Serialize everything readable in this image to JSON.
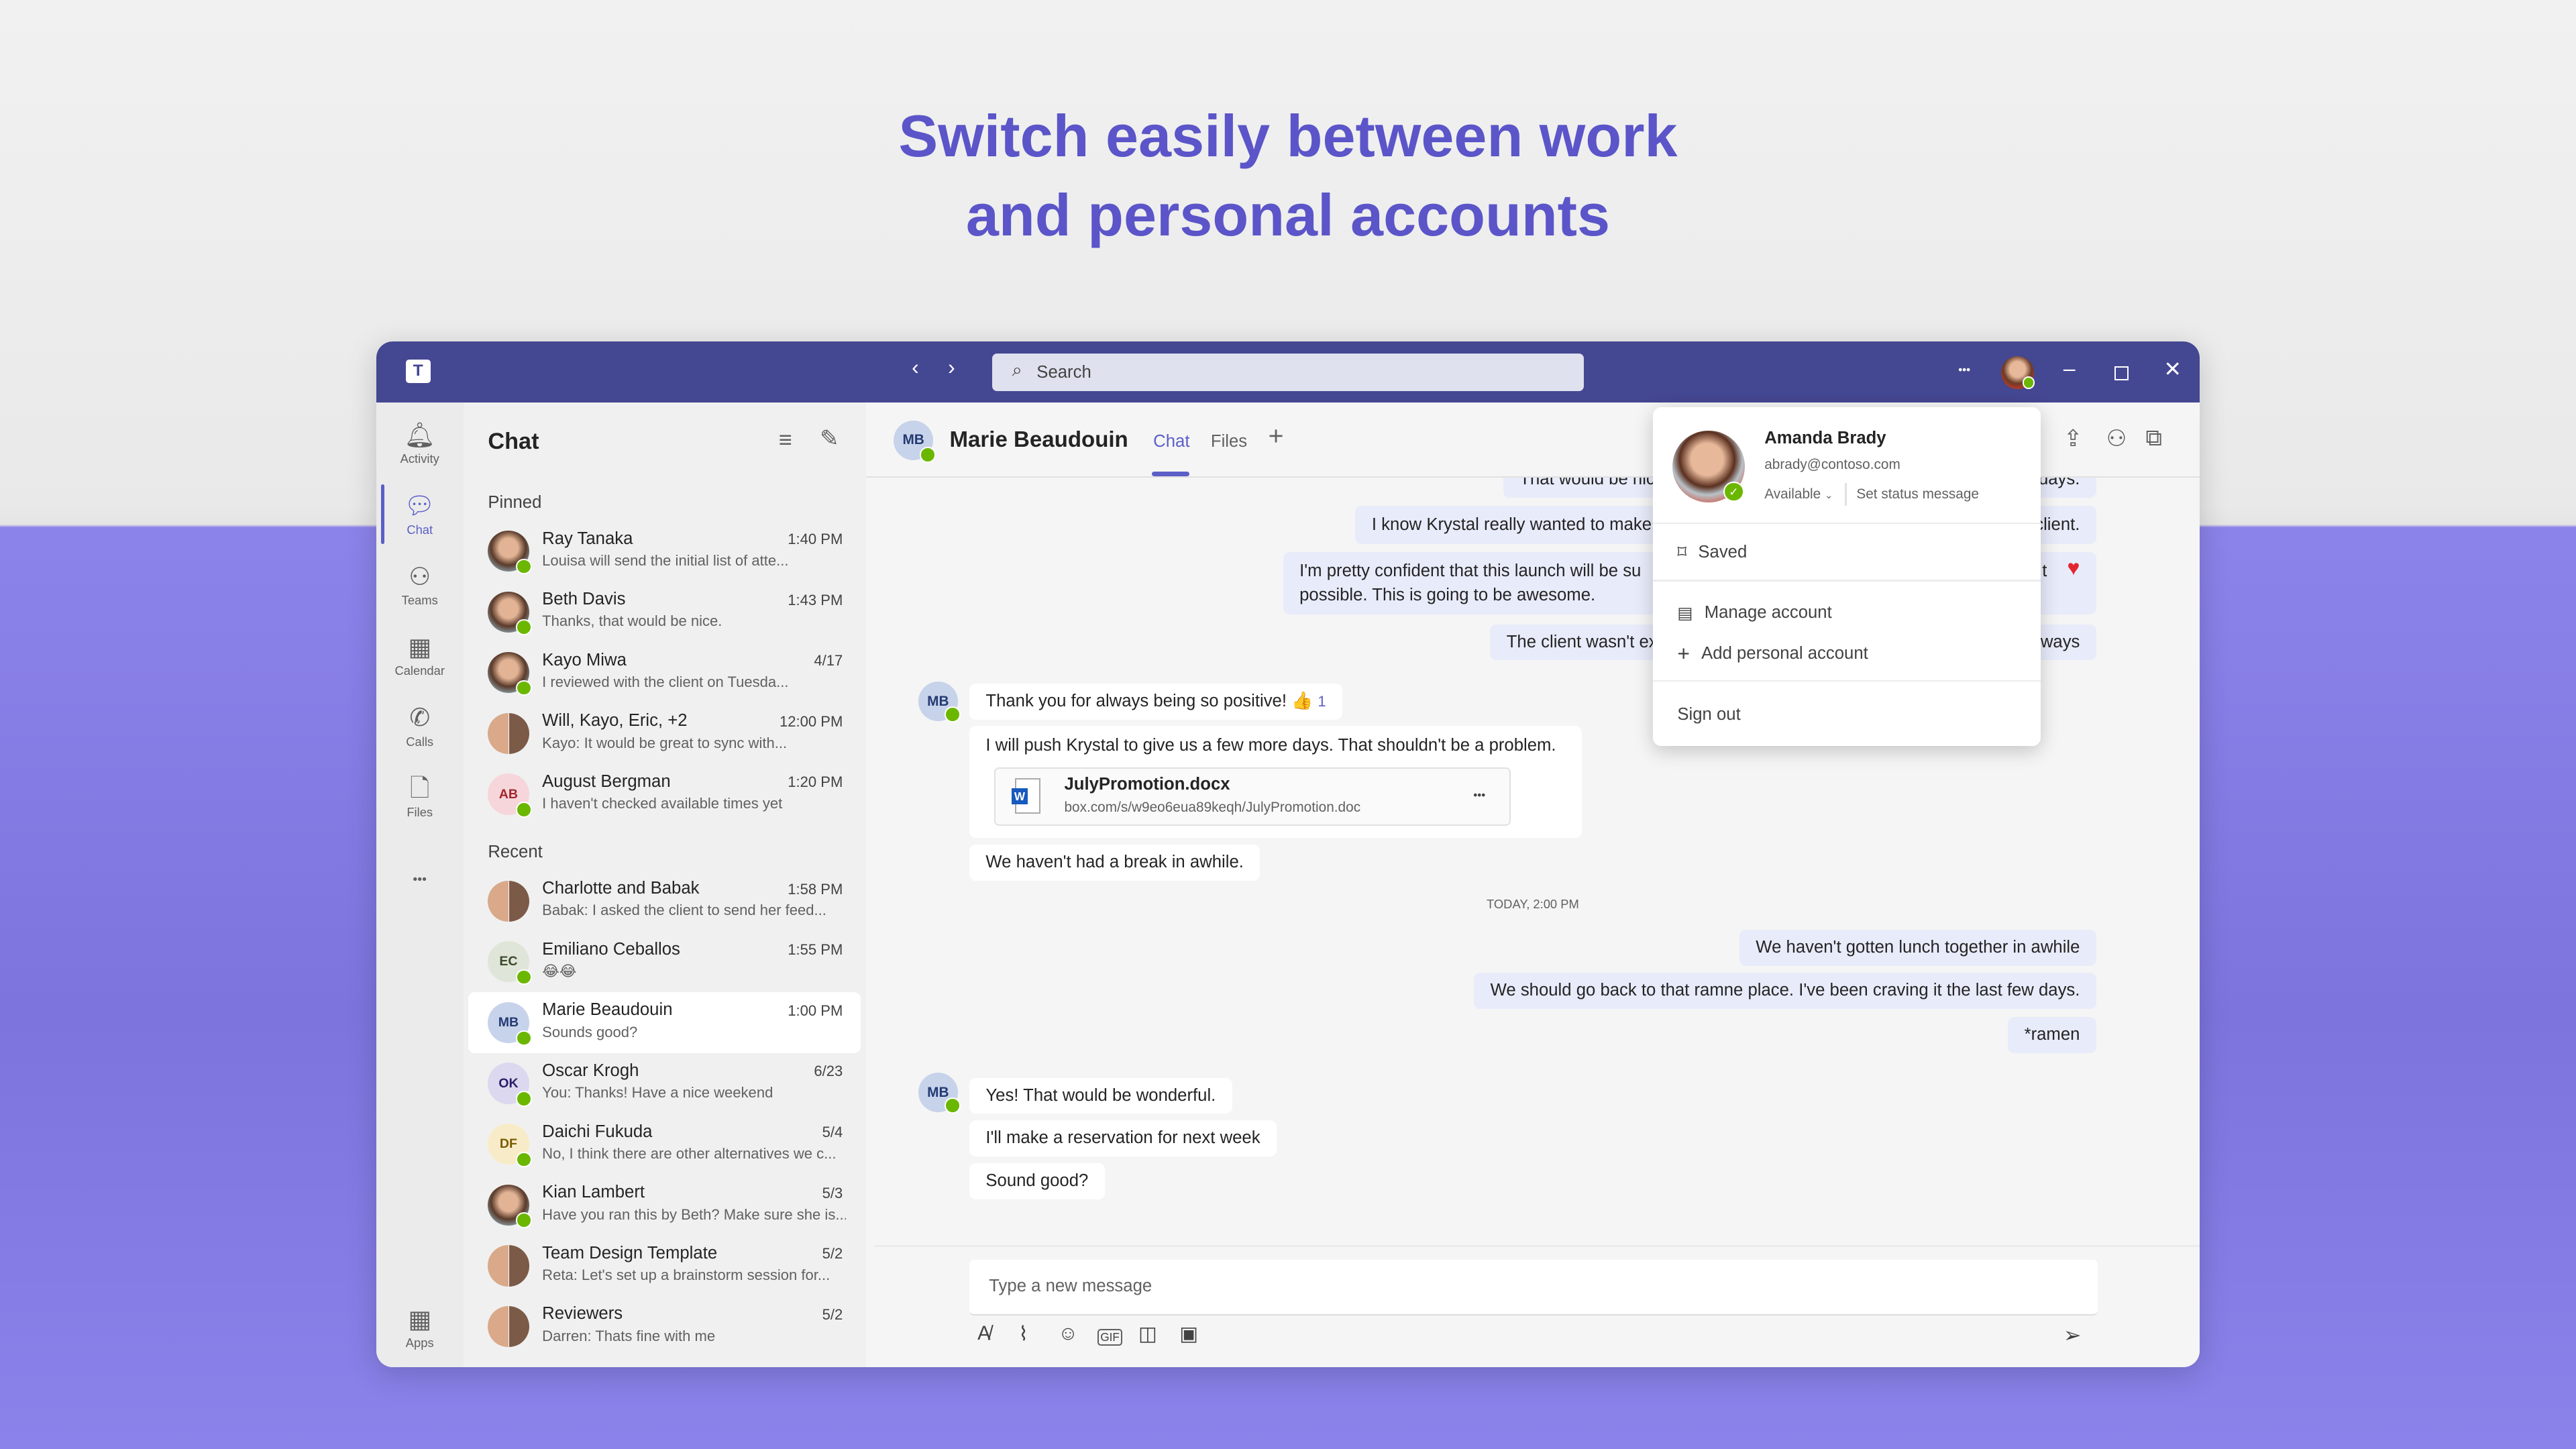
{
  "headline": {
    "line1": "Switch easily between work",
    "line2": "and personal accounts"
  },
  "colors": {
    "brand": "#444791",
    "accent": "#5b5fc7",
    "headline": "#5b55c9",
    "presence": "#6bb700",
    "my_bubble": "#e8ebfa",
    "heart": "#e3262f"
  },
  "titlebar": {
    "search_placeholder": "Search",
    "more": "•••",
    "icons": [
      "teams-logo-icon",
      "back-icon",
      "forward-icon",
      "search-icon",
      "more-icon",
      "minimize-icon",
      "maximize-icon",
      "close-icon"
    ]
  },
  "rail": {
    "items": [
      {
        "label": "Activity",
        "icon": "bell-icon"
      },
      {
        "label": "Chat",
        "icon": "chat-icon",
        "active": true
      },
      {
        "label": "Teams",
        "icon": "teams-icon"
      },
      {
        "label": "Calendar",
        "icon": "calendar-icon"
      },
      {
        "label": "Calls",
        "icon": "phone-icon"
      },
      {
        "label": "Files",
        "icon": "file-icon"
      }
    ],
    "more": "•••",
    "apps": "Apps"
  },
  "chatlist": {
    "title": "Chat",
    "pinned_label": "Pinned",
    "recent_label": "Recent",
    "pinned": [
      {
        "name": "Ray Tanaka",
        "time": "1:40 PM",
        "preview": "Louisa will send the initial list of atte...",
        "avatar": "photo"
      },
      {
        "name": "Beth Davis",
        "time": "1:43 PM",
        "preview": "Thanks, that would be nice.",
        "avatar": "photo"
      },
      {
        "name": "Kayo Miwa",
        "time": "4/17",
        "preview": "I reviewed with the client on Tuesda...",
        "avatar": "photo"
      },
      {
        "name": "Will, Kayo, Eric, +2",
        "time": "12:00 PM",
        "preview": "Kayo: It would be great to sync with...",
        "avatar": "group"
      },
      {
        "name": "August Bergman",
        "time": "1:20 PM",
        "preview": "I haven't checked available times yet",
        "initials": "AB",
        "bg": "#f6d6da",
        "fg": "#a4262c"
      }
    ],
    "recent": [
      {
        "name": "Charlotte and Babak",
        "time": "1:58 PM",
        "preview": "Babak: I asked the client to send her feed...",
        "avatar": "group"
      },
      {
        "name": "Emiliano Ceballos",
        "time": "1:55 PM",
        "preview": "😂😂",
        "initials": "EC",
        "bg": "#dfe5d8",
        "fg": "#3b4a2a"
      },
      {
        "name": "Marie Beaudouin",
        "time": "1:00 PM",
        "preview": "Sounds good?",
        "initials": "MB",
        "bg": "#c7d3ea",
        "fg": "#243a73",
        "selected": true
      },
      {
        "name": "Oscar Krogh",
        "time": "6/23",
        "preview": "You: Thanks! Have a nice weekend",
        "initials": "OK",
        "bg": "#dcd8ef",
        "fg": "#2b1e6b"
      },
      {
        "name": "Daichi Fukuda",
        "time": "5/4",
        "preview": "No, I think there are other alternatives we c...",
        "initials": "DF",
        "bg": "#f8ecc8",
        "fg": "#7a5a00"
      },
      {
        "name": "Kian Lambert",
        "time": "5/3",
        "preview": "Have you ran this by Beth? Make sure she is...",
        "avatar": "photo"
      },
      {
        "name": "Team Design Template",
        "time": "5/2",
        "preview": "Reta: Let's set up a brainstorm session for...",
        "avatar": "group"
      },
      {
        "name": "Reviewers",
        "time": "5/2",
        "preview": "Darren: Thats fine with me",
        "avatar": "group"
      }
    ]
  },
  "conversation": {
    "contact_initials": "MB",
    "contact_name": "Marie Beaudouin",
    "tabs": [
      {
        "label": "Chat",
        "active": true
      },
      {
        "label": "Files"
      }
    ],
    "add_tab": "+",
    "header_icons": [
      "share-screen-icon",
      "add-people-icon",
      "pop-out-icon"
    ],
    "obscured_messages": [
      {
        "left": "That would be nic",
        "right": "days."
      },
      {
        "left": "I know Krystal really wanted to make",
        "right": "client."
      },
      {
        "left": "I'm pretty confident that this launch will be su",
        "left2": "possible. This is going to be awesome.",
        "right": "t",
        "reaction": "heart"
      },
      {
        "left": "The client wasn't ex",
        "right": "ways"
      }
    ],
    "thanks_msg": "Thank you for always being so positive!",
    "thanks_reaction": "👍",
    "thanks_count": "1",
    "push_msg": "I will push Krystal to give us a few more days. That shouldn't be a problem.",
    "file": {
      "name": "JulyPromotion.docx",
      "url": "box.com/s/w9eo6eua89keqh/JulyPromotion.doc",
      "more": "•••"
    },
    "break_msg": "We haven't had a break in awhile.",
    "timestamp": "TODAY, 2:00 PM",
    "my_msgs": [
      "We haven't gotten lunch together in awhile",
      "We should go back to that ramne place. I've been craving it the last few days.",
      "*ramen"
    ],
    "their_msgs": [
      "Yes! That would be wonderful.",
      "I'll make a reservation for next week",
      "Sound good?"
    ],
    "compose_placeholder": "Type a new message",
    "compose_icons": [
      "format-icon",
      "attach-icon",
      "emoji-icon",
      "gif-icon",
      "sticker-icon",
      "schedule-meeting-icon",
      "send-icon"
    ]
  },
  "account_menu": {
    "name": "Amanda Brady",
    "email": "abrady@contoso.com",
    "status": "Available",
    "set_status": "Set status message",
    "saved": "Saved",
    "manage": "Manage account",
    "add_personal": "Add personal account",
    "sign_out": "Sign out"
  }
}
